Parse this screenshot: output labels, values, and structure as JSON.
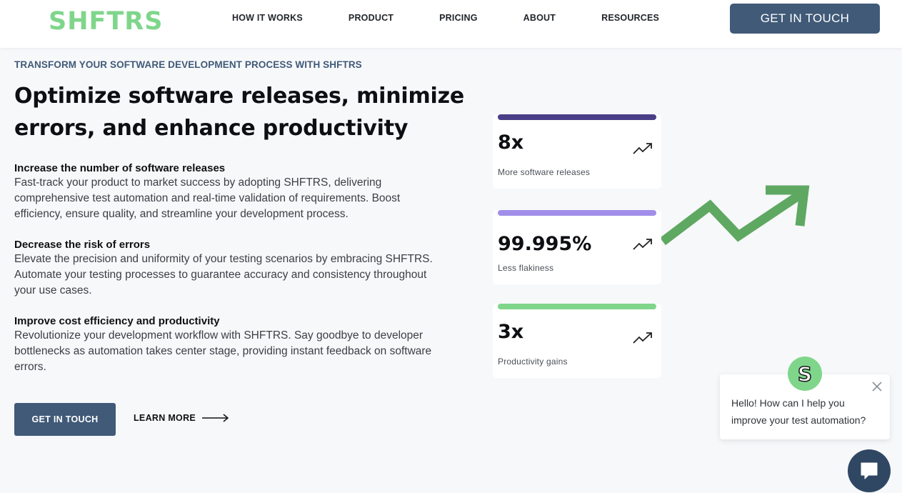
{
  "header": {
    "logo": "SHFTRS",
    "nav": [
      "HOW IT WORKS",
      "PRODUCT",
      "PRICING",
      "ABOUT",
      "RESOURCES"
    ],
    "cta": "GET IN TOUCH"
  },
  "hero": {
    "eyebrow": "TRANSFORM YOUR SOFTWARE DEVELOPMENT PROCESS WITH SHFTRS",
    "headline": "Optimize software releases, minimize errors, and enhance productivity",
    "features": [
      {
        "title": "Increase the number of software releases",
        "body": "Fast-track your product to market success by adopting SHFTRS, delivering comprehensive test automation and real-time validation of requirements. Boost efficiency, ensure quality, and streamline your development process."
      },
      {
        "title": "Decrease the risk of errors",
        "body": "Elevate the precision and uniformity of your testing scenarios by embracing SHFTRS. Automate your testing processes to guarantee accuracy and consistency throughout your use cases."
      },
      {
        "title": "Improve cost efficiency and productivity",
        "body": "Revolutionize your development workflow with SHFTRS. Say goodbye to developer bottlenecks as automation takes center stage, providing instant feedback on software errors."
      }
    ],
    "cta_primary": "GET IN TOUCH",
    "cta_secondary": "LEARN MORE"
  },
  "stats": [
    {
      "value": "8x",
      "caption": "More software releases",
      "color": "#4a3f87",
      "icon": "trending-up-icon"
    },
    {
      "value": "99.995%",
      "caption": "Less flakiness",
      "color": "#a08ee8",
      "icon": "trending-up-icon"
    },
    {
      "value": "3x",
      "caption": "Productivity gains",
      "color": "#7fd68b",
      "icon": "trending-up-icon"
    }
  ],
  "chat": {
    "avatar_letter": "S",
    "message": "Hello! How can I help you improve your test automation?"
  },
  "colors": {
    "brand_green": "#7fd68b",
    "primary_blue": "#405a78",
    "arrow_green": "#5fa862",
    "chat_launcher": "#2f4763"
  }
}
